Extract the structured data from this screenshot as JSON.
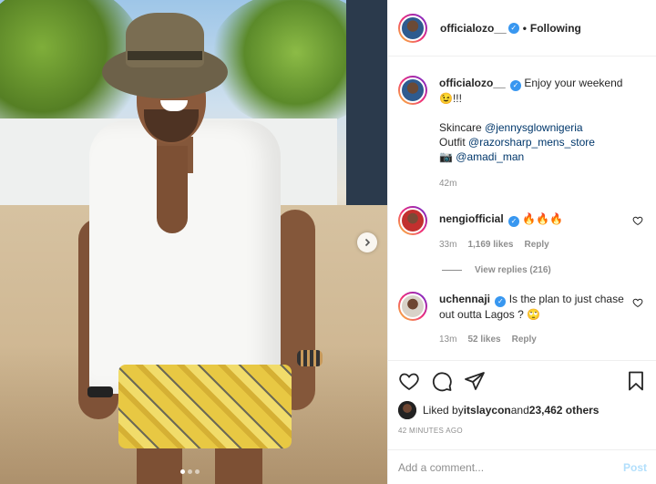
{
  "post": {
    "image_alt": "Man in white shirt, yellow shorts and fedora smiling on a beach",
    "carousel_count": 3,
    "carousel_active": 1
  },
  "header": {
    "username": "officialozo__",
    "separator": "•",
    "follow_state": "Following"
  },
  "caption": {
    "username": "officialozo__",
    "text_line1": "Enjoy your weekend",
    "text_line2": "😉!!!",
    "skincare_label": "Skincare ",
    "skincare_mention": "@jennysglownigeria",
    "outfit_label": "Outfit ",
    "outfit_mention": "@razorsharp_mens_store",
    "camera_emoji": "📷 ",
    "camera_mention": "@amadi_man",
    "time": "42m"
  },
  "comments": [
    {
      "username": "nengiofficial",
      "text": "🔥🔥🔥",
      "time": "33m",
      "likes": "1,169 likes",
      "reply": "Reply",
      "view_replies": "View replies (216)"
    },
    {
      "username": "uchennaji",
      "text": "Is the plan to just chase out outta Lagos ? 🙄",
      "time": "13m",
      "likes": "52 likes",
      "reply": "Reply"
    }
  ],
  "likes": {
    "prefix": "Liked by ",
    "user": "itslaycon",
    "middle": " and ",
    "count": "23,462 others"
  },
  "timestamp": "42 MINUTES AGO",
  "add_comment": {
    "placeholder": "Add a comment...",
    "post_label": "Post"
  },
  "icons": {
    "verified": "verified-badge",
    "heart": "heart-icon",
    "comment": "comment-icon",
    "share": "share-icon",
    "bookmark": "bookmark-icon",
    "next": "chevron-right-icon"
  },
  "colors": {
    "verified": "#3897f0",
    "muted": "#8e8e8e",
    "mention": "#00376b",
    "post_disabled": "#b2dffc"
  }
}
